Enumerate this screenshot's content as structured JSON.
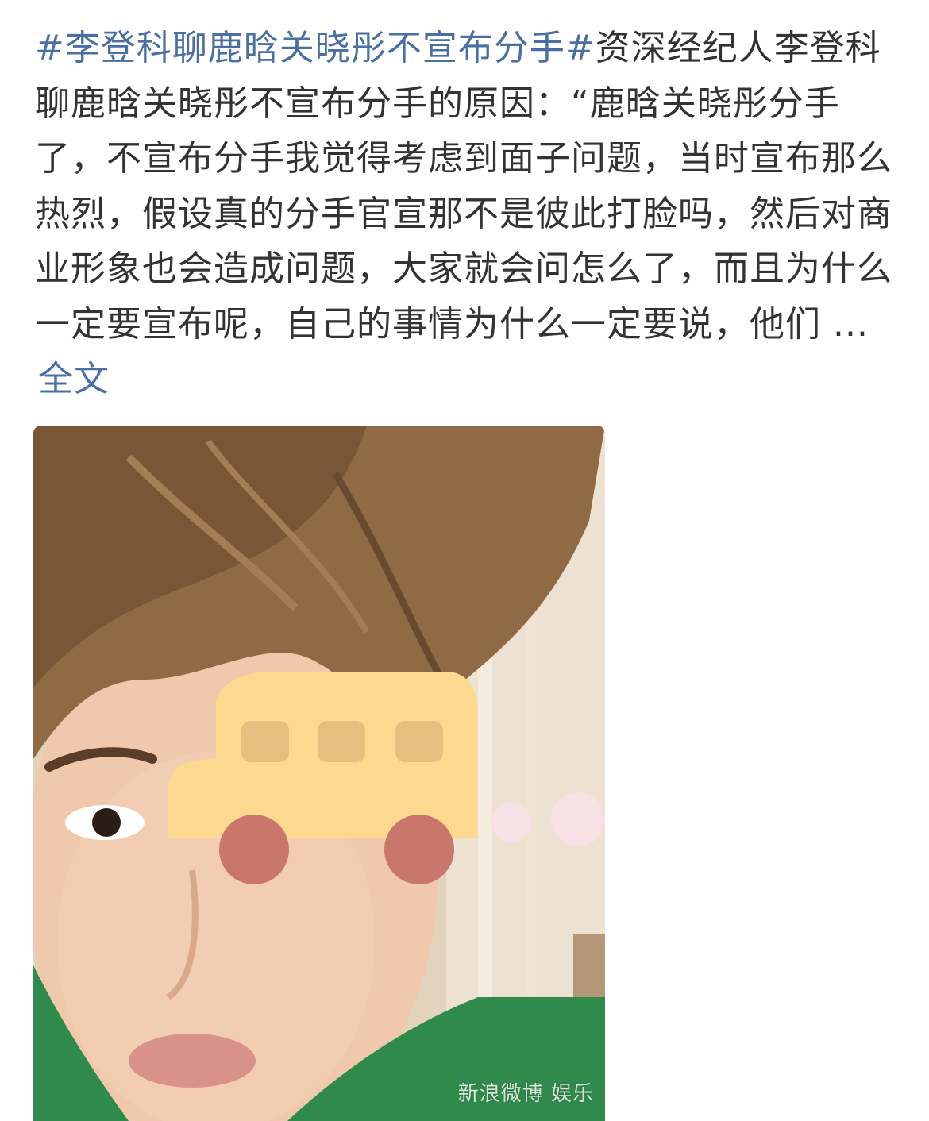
{
  "post": {
    "hashtag_1": "#李登科聊鹿晗关晓彤不宣布分手#",
    "hashtag_2": "#",
    "body": "资深经纪人李登科聊鹿晗关晓彤不宣布分手的原因：“鹿晗关晓彤分手了，不宣布分手我觉得考虑到面子问题，当时宣布那么热烈，假设真的分手官宣那不是彼此打脸吗，然后对商业形象也会造成问题，大家就会问怎么了，而且为什么一定要宣布呢，自己的事情为什么一定要说，他们 ...",
    "full_text_label": "全文"
  },
  "image": {
    "watermark": "新浪微博 娱乐"
  },
  "colors": {
    "link": "#4a6fa5",
    "text": "#333333",
    "sticker_body": "#fcd98f",
    "sticker_wheel": "#c8776a",
    "sticker_dot": "#f9e0e6"
  }
}
